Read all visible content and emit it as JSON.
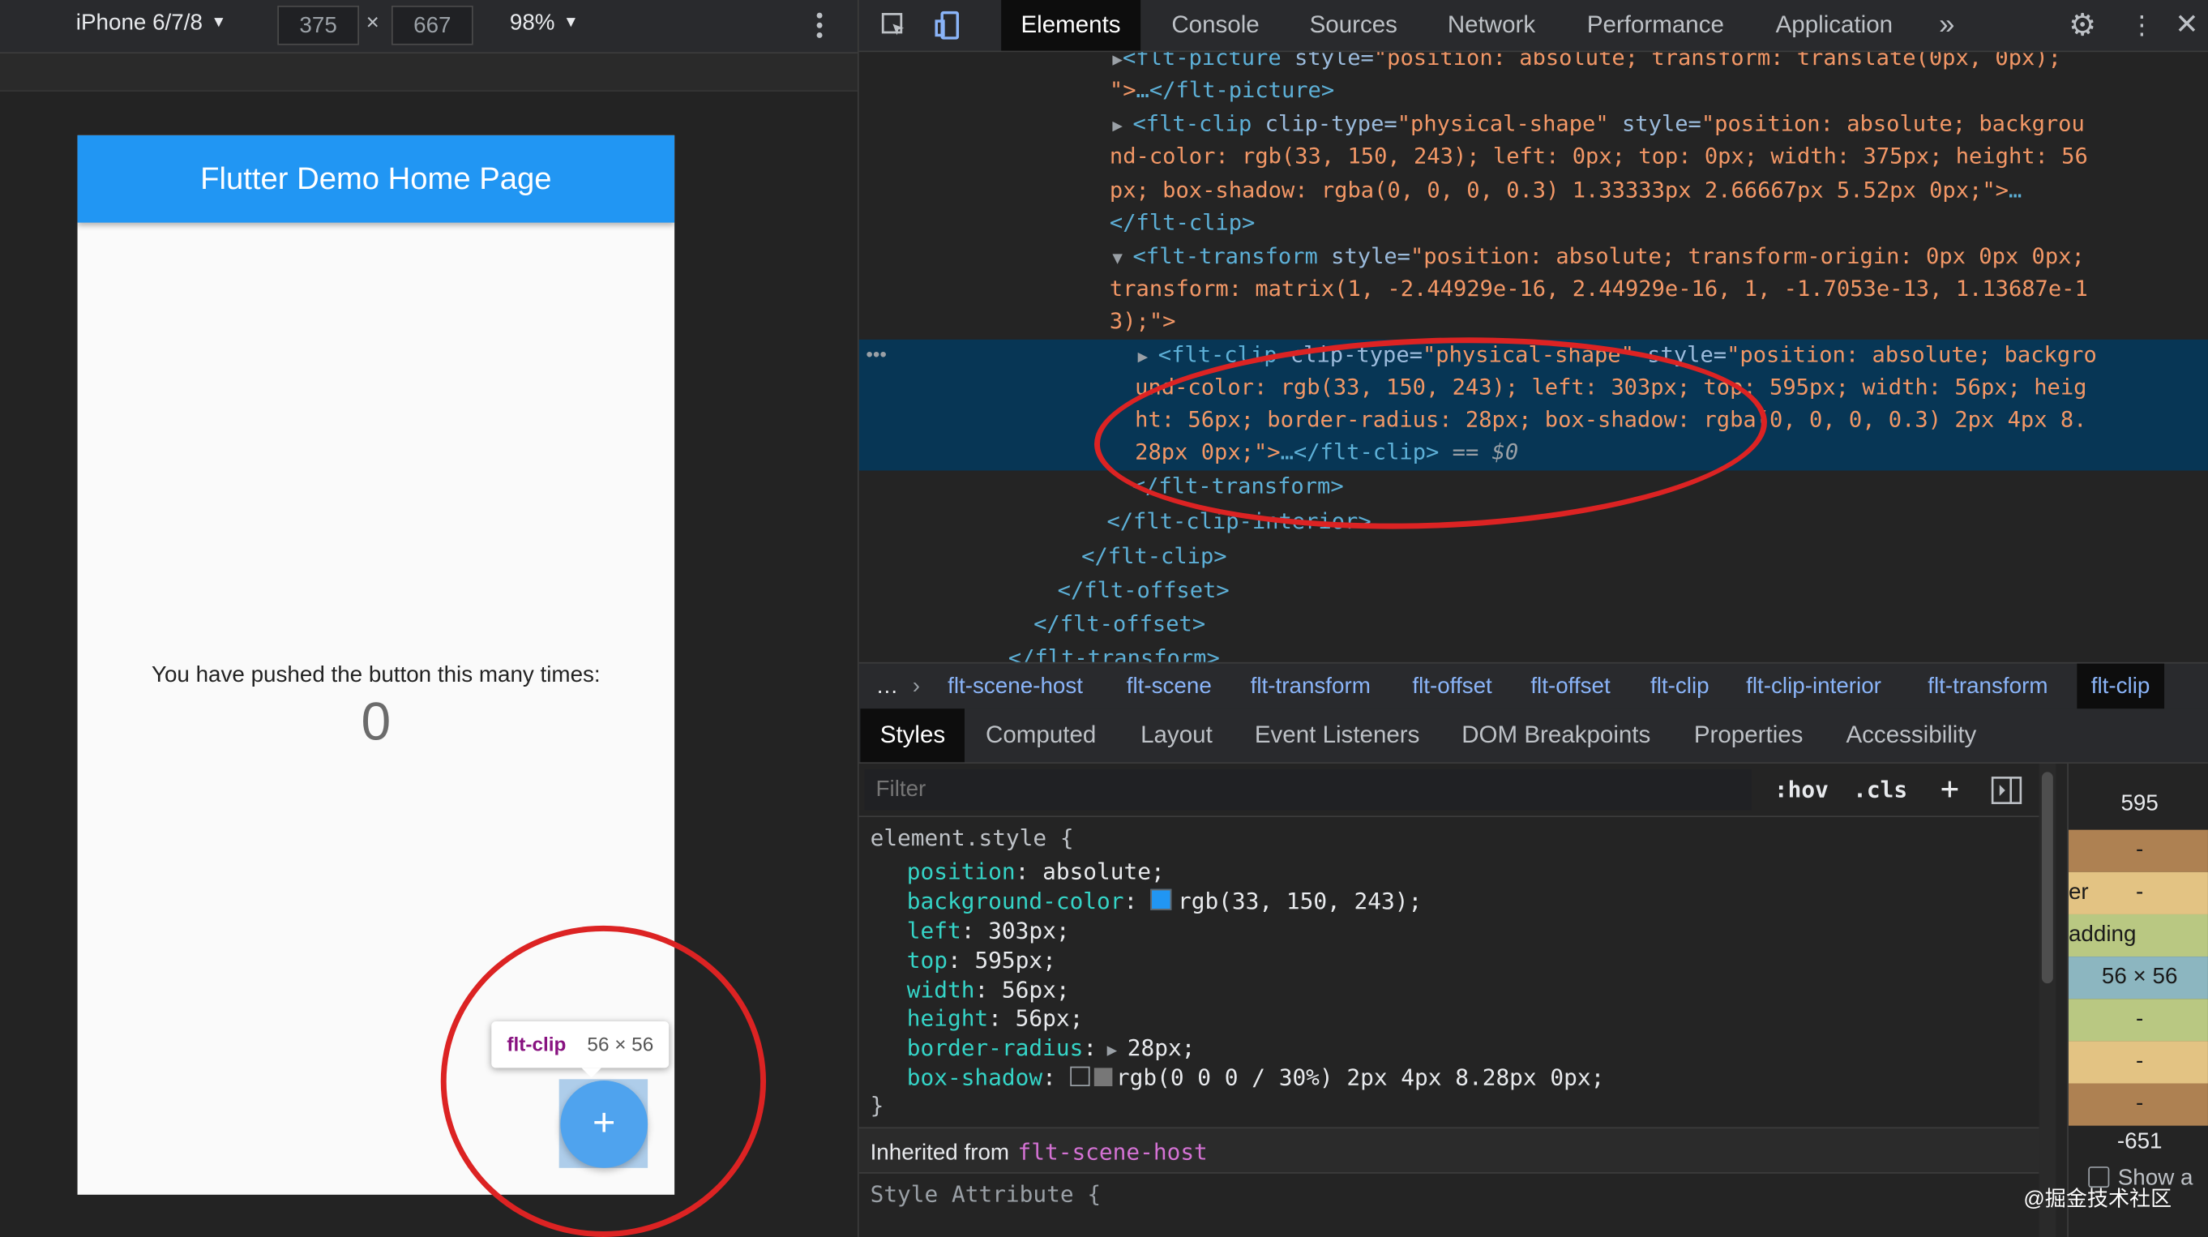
{
  "device_toolbar": {
    "device": "iPhone 6/7/8",
    "width": "375",
    "times": "×",
    "height": "667",
    "zoom": "98%"
  },
  "phone": {
    "appbar_title": "Flutter Demo Home Page",
    "counter_label": "You have pushed the button this many times:",
    "counter_value": "0",
    "fab_icon": "+",
    "tooltip_tag": "flt-clip",
    "tooltip_size": "56 × 56"
  },
  "devtools": {
    "tabs": [
      "Elements",
      "Console",
      "Sources",
      "Network",
      "Performance",
      "Application"
    ],
    "more_tabs": "»",
    "elements_lines": {
      "l1_tag": "<flt-picture",
      "l1_attr": " style=",
      "l1_val": "\"position: absolute; transform: translate(0px, 0px);",
      "l2_val": "\">",
      "l2_rest": "…</flt-picture>",
      "l3_tag": "<flt-clip",
      "l3_attr1": " clip-type=",
      "l3_val1": "\"physical-shape\"",
      "l3_attr2": " style=",
      "l3_val2": "\"position: absolute; backgrou",
      "l4_val": "nd-color: rgb(33, 150, 243); left: 0px; top: 0px; width: 375px; height: 56",
      "l5_val": "px; box-shadow: rgba(0, 0, 0, 0.3) 1.33333px 2.66667px 5.52px 0px;\">",
      "l5_rest": "…",
      "l6_tag": "</flt-clip>",
      "l7_tag": "<flt-transform",
      "l7_attr": " style=",
      "l7_val": "\"position: absolute; transform-origin: 0px 0px 0px;",
      "l8_val": "transform: matrix(1, -2.44929e-16, 2.44929e-16, 1, -1.7053e-13, 1.13687e-1",
      "l9_val": "3);\">",
      "sel1_tag": "<flt-clip",
      "sel1_attr1": " clip-type=",
      "sel1_val1": "\"physical-shape\"",
      "sel1_attr2": " style=",
      "sel1_val2": "\"position: absolute; backgro",
      "sel2_val": "und-color: rgb(33, 150, 243); left: 303px; top: 595px; width: 56px; heig",
      "sel3_val": "ht: 56px; border-radius: 28px; box-shadow: rgba(0, 0, 0, 0.3) 2px 4px 8.",
      "sel4_val": "28px 0px;\">",
      "sel4_rest": "…</flt-clip>",
      "sel4_eq": " == $0",
      "l10_tag": "</flt-transform>",
      "l11_tag": "</flt-clip-interior>",
      "l12_tag": "</flt-clip>",
      "l13_tag": "</flt-offset>",
      "l14_tag": "</flt-offset>",
      "l15_tag": "</flt-transform>"
    },
    "breadcrumbs": [
      "flt-scene-host",
      "flt-scene",
      "flt-transform",
      "flt-offset",
      "flt-offset",
      "flt-clip",
      "flt-clip-interior",
      "flt-transform",
      "flt-clip"
    ],
    "breadcrumb_more": "…",
    "subtabs": [
      "Styles",
      "Computed",
      "Layout",
      "Event Listeners",
      "DOM Breakpoints",
      "Properties",
      "Accessibility"
    ],
    "filter_placeholder": "Filter",
    "filter_hov": ":hov",
    "filter_cls": ".cls",
    "filter_plus": "+",
    "styles": {
      "selector": "element.style {",
      "props": [
        {
          "name": "position",
          "value": "absolute;"
        },
        {
          "name": "background-color",
          "value": "rgb(33, 150, 243);"
        },
        {
          "name": "left",
          "value": "303px;"
        },
        {
          "name": "top",
          "value": "595px;"
        },
        {
          "name": "width",
          "value": "56px;"
        },
        {
          "name": "height",
          "value": "56px;"
        },
        {
          "name": "border-radius",
          "value": "28px;"
        },
        {
          "name": "box-shadow",
          "value": "rgb(0 0 0 / 30%) 2px 4px 8.28px 0px;"
        }
      ],
      "close": "}",
      "inherited_label": "Inherited from",
      "inherited_link": "flt-scene-host",
      "style_attr": "Style Attribute {"
    },
    "box_model": {
      "top": "595",
      "margin_val": "-",
      "border_label": "er",
      "border_val": "-",
      "padding_label": "adding",
      "content": "56 × 56",
      "pad_bottom": "-",
      "border_bottom": "-",
      "margin_bottom": "-",
      "bottom": "-651",
      "show_all": "Show a"
    }
  },
  "watermark": "@掘金技术社区",
  "colors": {
    "flutter_blue": "#2196f3",
    "annotation_red": "#dc2323"
  }
}
